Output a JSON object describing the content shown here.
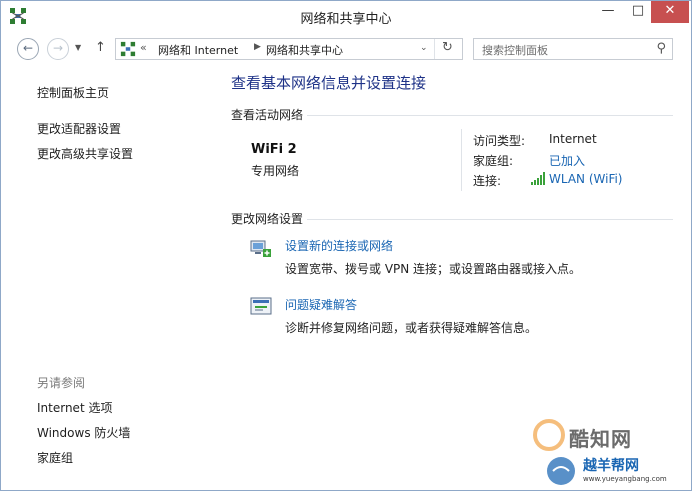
{
  "window": {
    "title": "网络和共享中心",
    "minimize_glyph": "—",
    "maximize_glyph": "□",
    "close_glyph": "✕"
  },
  "nav": {
    "back_glyph": "←",
    "forward_glyph": "→",
    "recent_glyph": "▼",
    "up_glyph": "↑",
    "address_separator": "«",
    "breadcrumbs": [
      "网络和 Internet",
      "网络和共享中心"
    ],
    "crumb_arrow_glyph": "▶",
    "dropdown_glyph": "⌄",
    "refresh_glyph": "↻",
    "search_placeholder": "搜索控制面板",
    "search_glyph": "⚲"
  },
  "sidebar": {
    "items": [
      {
        "label": "控制面板主页"
      },
      {
        "label": "更改适配器设置"
      },
      {
        "label": "更改高级共享设置"
      }
    ],
    "see_also_label": "另请参阅",
    "see_also_items": [
      {
        "label": "Internet 选项"
      },
      {
        "label": "Windows 防火墙"
      },
      {
        "label": "家庭组"
      }
    ]
  },
  "main": {
    "heading": "查看基本网络信息并设置连接",
    "active_networks_title": "查看活动网络",
    "network": {
      "name": "WiFi  2",
      "type": "专用网络",
      "props": [
        {
          "label": "访问类型:",
          "value": "Internet",
          "is_link": false
        },
        {
          "label": "家庭组:",
          "value": "已加入",
          "is_link": true
        },
        {
          "label": "连接:",
          "value": "WLAN (WiFi)",
          "is_link": true
        }
      ]
    },
    "change_settings_title": "更改网络设置",
    "tasks": [
      {
        "link": "设置新的连接或网络",
        "desc": "设置宽带、拨号或 VPN 连接；或设置路由器或接入点。"
      },
      {
        "link": "问题疑难解答",
        "desc": "诊断并修复网络问题，或者获得疑难解答信息。"
      }
    ]
  },
  "watermark": {
    "text1": "酷知网",
    "text2": "越羊帮网",
    "url": "www.yueyangbang.com"
  },
  "colors": {
    "heading": "#1e3287",
    "link": "#1a66b3",
    "close_button": "#c75050"
  }
}
